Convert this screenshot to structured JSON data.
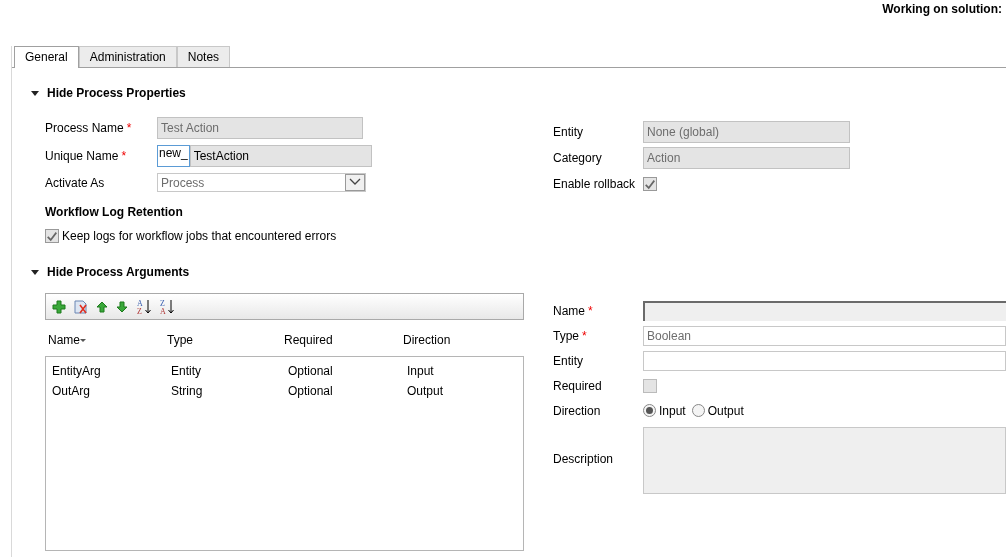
{
  "header": {
    "text": "Working on solution:"
  },
  "required_mark": "*",
  "tabs": [
    {
      "label": "General",
      "selected": true
    },
    {
      "label": "Administration",
      "selected": false
    },
    {
      "label": "Notes",
      "selected": false
    }
  ],
  "properties": {
    "title": "Hide Process Properties",
    "expanded": true,
    "fields": [
      {
        "label": "Process Name",
        "required": true,
        "kind": "text",
        "value": "Test Action"
      },
      {
        "label": "Unique Name",
        "required": true,
        "kind": "prefixed",
        "prefix": "new_",
        "value": "TestAction"
      },
      {
        "label": "Activate As",
        "required": false,
        "kind": "select",
        "value": "Process"
      }
    ],
    "side_fields": [
      {
        "label": "Entity",
        "kind": "text",
        "value": "None (global)"
      },
      {
        "label": "Category",
        "kind": "text",
        "value": "Action"
      },
      {
        "label": "Enable rollback",
        "kind": "checkbox",
        "checked": true
      }
    ],
    "log_retention": {
      "title": "Workflow Log Retention",
      "label": "Keep logs for workflow jobs that encountered errors",
      "checked": true
    }
  },
  "arguments": {
    "title": "Hide Process Arguments",
    "expanded": true,
    "toolbar": [
      {
        "kind": "add"
      },
      {
        "kind": "delete"
      },
      {
        "kind": "up"
      },
      {
        "kind": "down"
      },
      {
        "kind": "sort",
        "glyphs": [
          "A",
          "Z"
        ]
      },
      {
        "kind": "sort",
        "glyphs": [
          "Z",
          "A"
        ]
      }
    ],
    "columns": [
      {
        "label": "Name",
        "sorted": true
      },
      {
        "label": "Type",
        "sorted": false
      },
      {
        "label": "Required",
        "sorted": false
      },
      {
        "label": "Direction",
        "sorted": false
      }
    ],
    "rows": [
      [
        "EntityArg",
        "Entity",
        "Optional",
        "Input"
      ],
      [
        "OutArg",
        "String",
        "Optional",
        "Output"
      ]
    ],
    "form": [
      {
        "label": "Name",
        "required": true,
        "kind": "text",
        "focused": true,
        "disabled": true
      },
      {
        "label": "Type",
        "required": true,
        "kind": "text",
        "value": "Boolean",
        "focused": false,
        "disabled": false
      },
      {
        "label": "Entity",
        "required": false,
        "kind": "text",
        "focused": false,
        "disabled": false
      },
      {
        "label": "Required",
        "required": false,
        "kind": "checkbox",
        "checked": false
      },
      {
        "label": "Direction",
        "required": false,
        "kind": "radio",
        "options": [
          {
            "label": "Input",
            "selected": true
          },
          {
            "label": "Output",
            "selected": false
          }
        ]
      },
      {
        "label": "Description",
        "required": false,
        "kind": "textarea",
        "disabled": true
      }
    ]
  }
}
